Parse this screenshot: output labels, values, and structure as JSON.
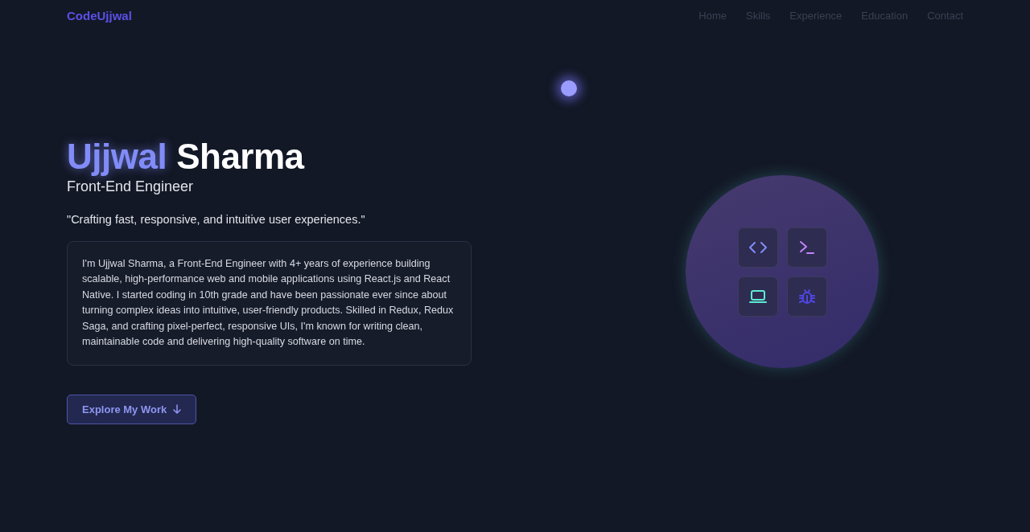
{
  "nav": {
    "logo": "CodeUjjwal",
    "links": [
      {
        "label": "Home"
      },
      {
        "label": "Skills"
      },
      {
        "label": "Experience"
      },
      {
        "label": "Education"
      },
      {
        "label": "Contact"
      }
    ]
  },
  "hero": {
    "first_name": "Ujjwal",
    "last_name": "Sharma",
    "role": "Front-End Engineer",
    "tagline": "\"Crafting fast, responsive, and intuitive user experiences.\"",
    "bio": "I'm Ujjwal Sharma, a Front-End Engineer with 4+ years of experience building scalable, high-performance web and mobile applications using React.js and React Native. I started coding in 10th grade and have been passionate ever since about turning complex ideas into intuitive, user-friendly products. Skilled in Redux, Redux Saga, and crafting pixel-perfect, responsive UIs, I'm known for writing clean, maintainable code and delivering high-quality software on time.",
    "button": "Explore My Work"
  },
  "tiles": [
    {
      "kind": "code"
    },
    {
      "kind": "terminal"
    },
    {
      "kind": "laptop"
    },
    {
      "kind": "bug"
    }
  ]
}
